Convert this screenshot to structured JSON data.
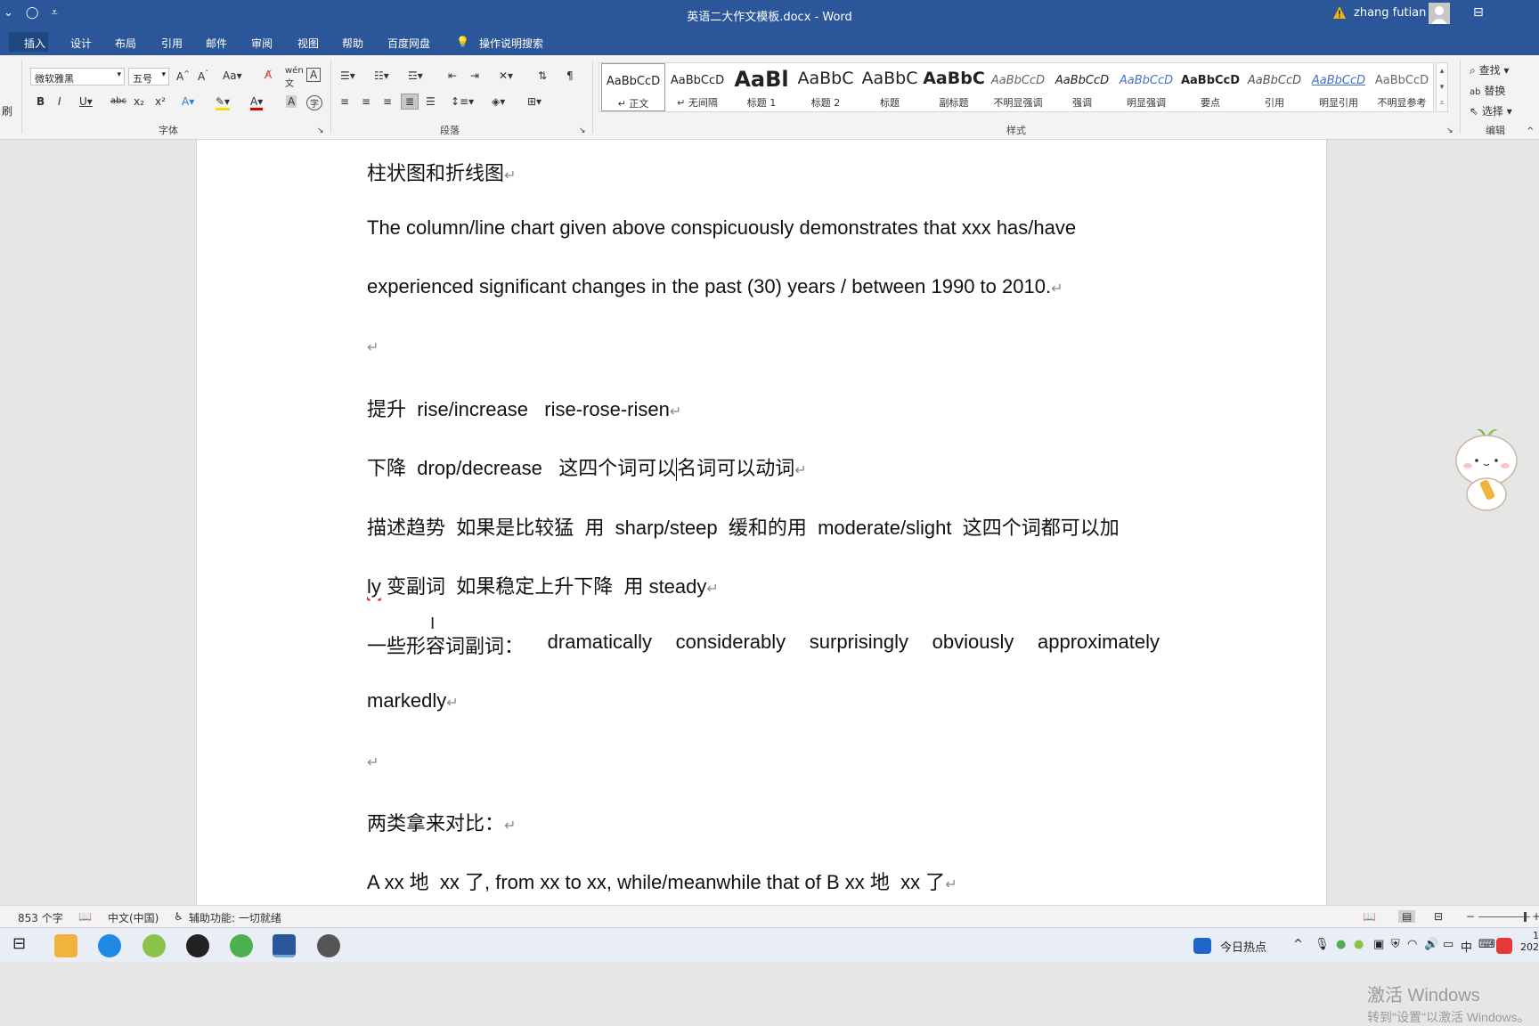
{
  "window": {
    "title": "英语二大作文模板.docx  -  Word",
    "user": "zhang futian",
    "qat": [
      "⌄",
      "◯",
      "⩡"
    ]
  },
  "menu": [
    "插入",
    "设计",
    "布局",
    "引用",
    "邮件",
    "审阅",
    "视图",
    "帮助",
    "百度网盘",
    "操作说明搜索"
  ],
  "ribbon": {
    "font_name": "微软雅黑",
    "font_size": "五号",
    "font_group_label": "字体",
    "paragraph_group_label": "段落",
    "styles_group_label": "样式",
    "edit_group_label": "编辑",
    "find_label": "查找",
    "replace_label": "替换",
    "select_label": "选择",
    "left_edge_label": "刷",
    "styles": [
      {
        "preview": "AaBbCcD",
        "name": "↵ 正文"
      },
      {
        "preview": "AaBbCcD",
        "name": "↵ 无间隔"
      },
      {
        "preview": "AaBl",
        "name": "标题 1"
      },
      {
        "preview": "AaBbC",
        "name": "标题 2"
      },
      {
        "preview": "AaBbC",
        "name": "标题"
      },
      {
        "preview": "AaBbC",
        "name": "副标题"
      },
      {
        "preview": "AaBbCcD",
        "name": "不明显强调"
      },
      {
        "preview": "AaBbCcD",
        "name": "强调"
      },
      {
        "preview": "AaBbCcD",
        "name": "明显强调"
      },
      {
        "preview": "AaBbCcD",
        "name": "要点"
      },
      {
        "preview": "AaBbCcD",
        "name": "引用"
      },
      {
        "preview": "AaBbCcD",
        "name": "明显引用"
      },
      {
        "preview": "AaBbCcD",
        "name": "不明显参考"
      }
    ]
  },
  "document": {
    "p1": "柱状图和折线图",
    "p2a": "The column/line chart given above conspicuously demonstrates that xxx has/have",
    "p2b": "experienced significant changes in the past (30) years / between 1990 to 2010.",
    "p3": "提升  rise/increase   rise-rose-risen",
    "p4a": "下降  drop/decrease   这四个词可以",
    "p4b": "名词可以动词",
    "p5a": "描述趋势  如果是比较猛  用  sharp/steep  缓和的用  moderate/slight  这四个词都可以加",
    "p5b_ly": "ly",
    "p5b_rest": " 变副词  如果稳定上升下降  用 steady",
    "p6_words": [
      "一些形容词副词：",
      "dramatically",
      "considerably",
      "surprisingly",
      "obviously",
      "approximately"
    ],
    "p6b": "markedly",
    "p7": "两类拿来对比：",
    "p8": "A xx 地  xx 了, from xx to xx, while/meanwhile that of B xx 地  xx 了",
    "para_mark": "↵"
  },
  "status": {
    "word_count": "853 个字",
    "language": "中文(中国)",
    "accessibility": "辅助功能: 一切就绪"
  },
  "watermark": {
    "line1": "激活 Windows",
    "line2": "转到\"设置\"以激活 Windows。"
  },
  "taskbar": {
    "news_label": "今日热点",
    "ime": "中",
    "clock_top": "1",
    "clock_bottom": "202"
  },
  "colors": {
    "word_blue": "#2b579a",
    "ribbon_bg": "#f3f3f3",
    "doc_bg": "#e6e6e6"
  }
}
